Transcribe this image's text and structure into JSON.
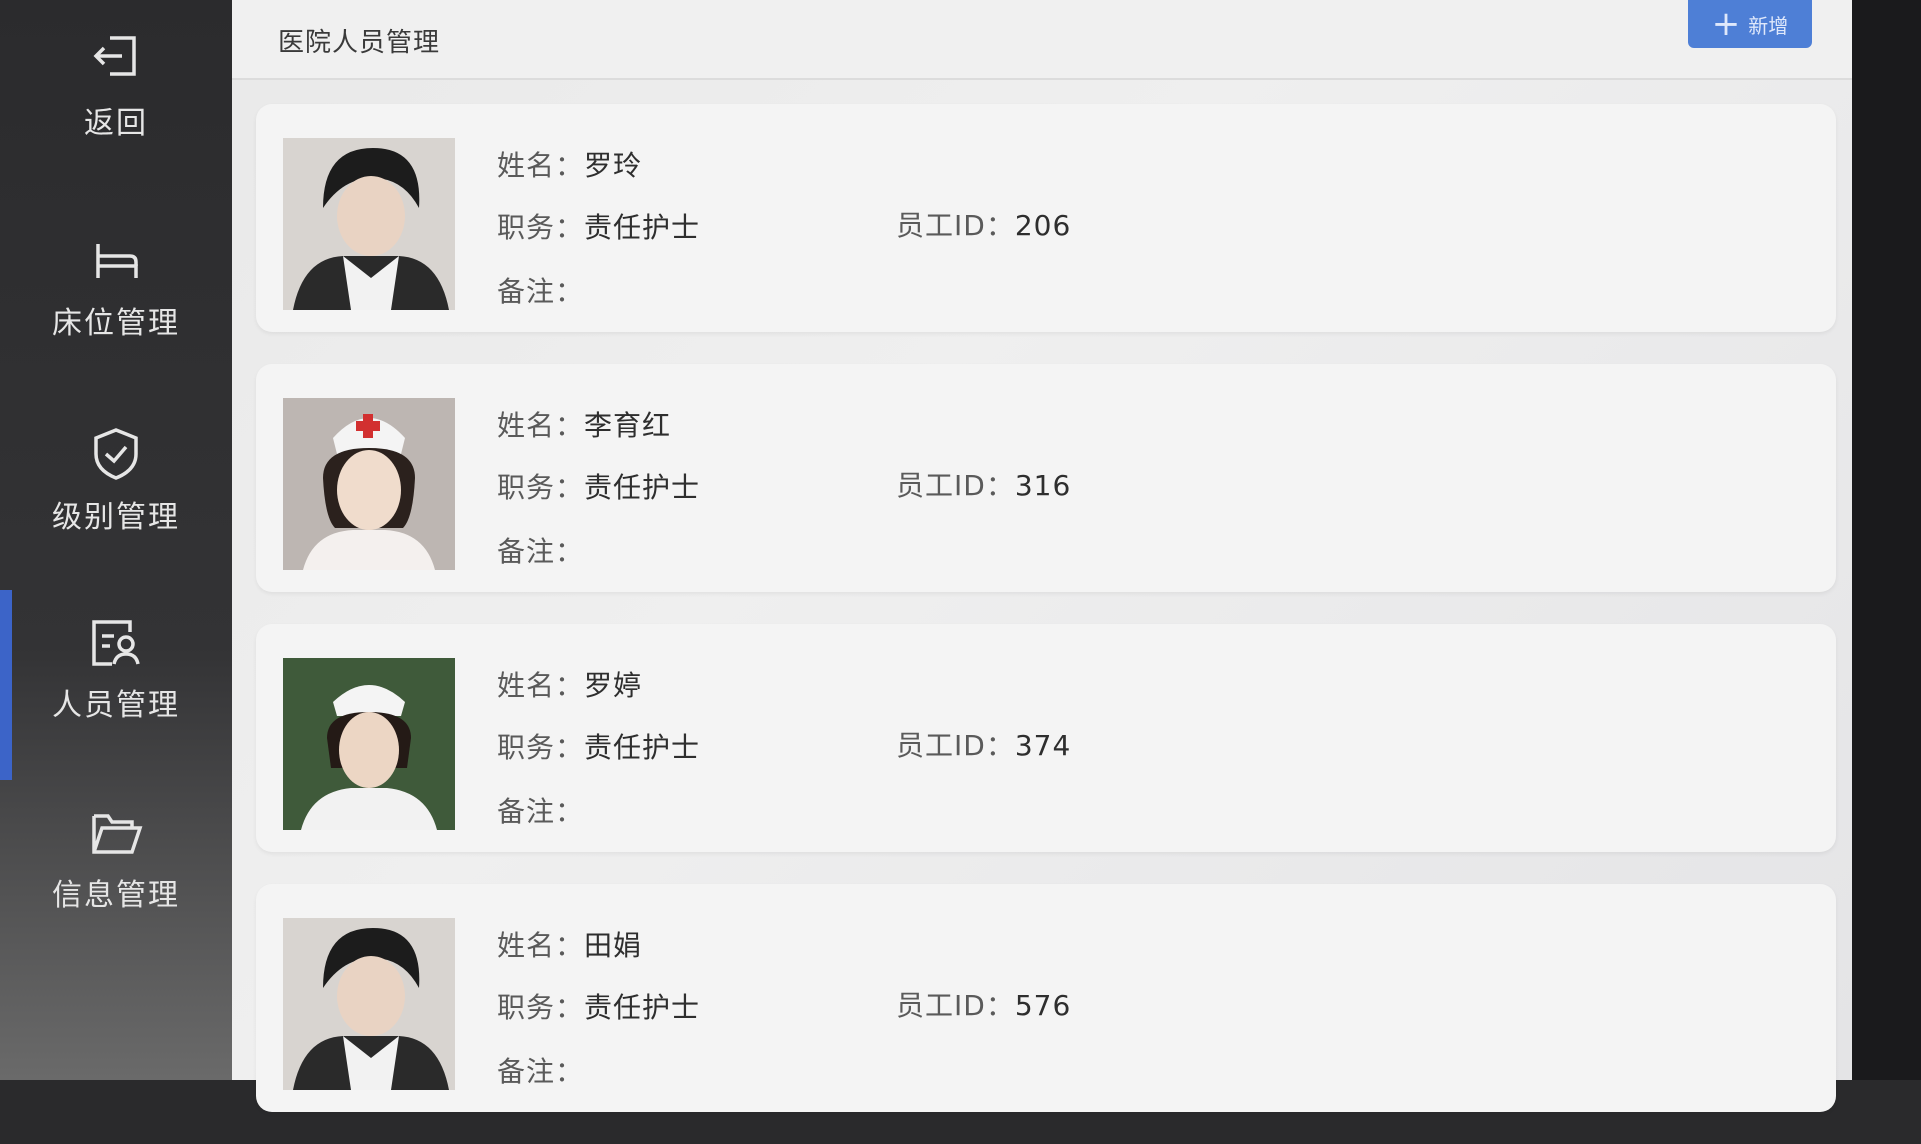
{
  "sidebar": {
    "items": [
      {
        "label": "返回",
        "icon": "back-icon"
      },
      {
        "label": "床位管理",
        "icon": "bed-icon"
      },
      {
        "label": "级别管理",
        "icon": "shield-check-icon"
      },
      {
        "label": "人员管理",
        "icon": "staff-card-icon",
        "active": true
      },
      {
        "label": "信息管理",
        "icon": "folder-icon"
      }
    ]
  },
  "header": {
    "title": "医院人员管理",
    "add_label": "新增"
  },
  "labels": {
    "name": "姓名：",
    "role": "职务：",
    "note": "备注：",
    "staff_id": "员工ID："
  },
  "staff": [
    {
      "name": "罗玲",
      "role": "责任护士",
      "id": "206",
      "note": ""
    },
    {
      "name": "李育红",
      "role": "责任护士",
      "id": "316",
      "note": ""
    },
    {
      "name": "罗婷",
      "role": "责任护士",
      "id": "374",
      "note": ""
    },
    {
      "name": "田娟",
      "role": "责任护士",
      "id": "576",
      "note": ""
    }
  ],
  "colors": {
    "accent": "#3c64c8",
    "add_button": "#4e7fd6",
    "sidebar": "#2b2b2d",
    "card": "#f4f4f4"
  }
}
